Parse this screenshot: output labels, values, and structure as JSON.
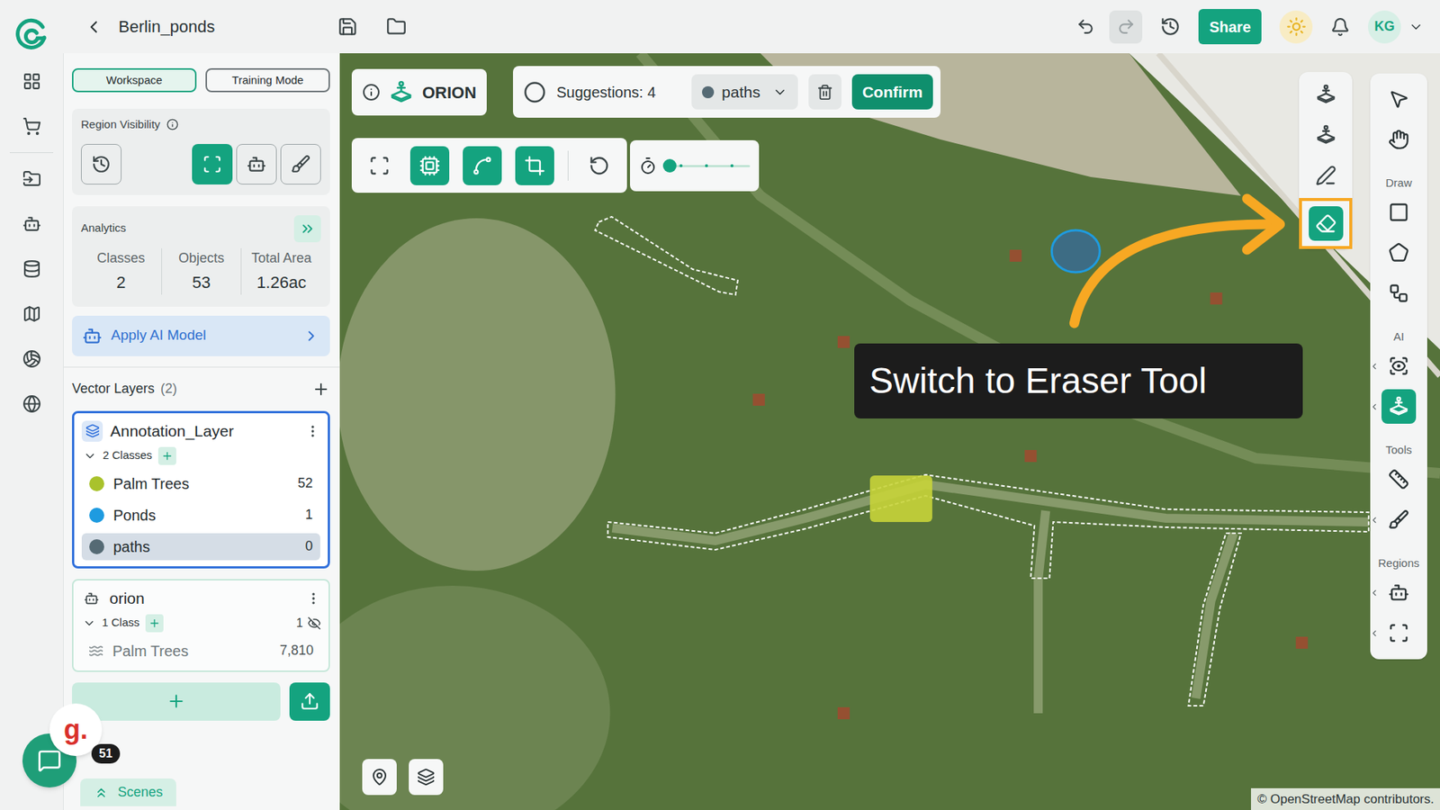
{
  "header": {
    "title": "Berlin_ponds",
    "undo_disabled": false,
    "redo_disabled": true,
    "share": "Share",
    "user_initials": "KG"
  },
  "mode_tabs": [
    {
      "label": "Workspace",
      "selected": true
    },
    {
      "label": "Training Mode",
      "selected": false
    }
  ],
  "region_visibility": {
    "label": "Region Visibility",
    "buttons": [
      {
        "kind": "history",
        "selected": false
      },
      {
        "kind": "full",
        "selected": true
      },
      {
        "kind": "robot",
        "selected": false
      },
      {
        "kind": "brush",
        "selected": false
      }
    ]
  },
  "analytics": {
    "title": "Analytics",
    "stats": [
      {
        "label": "Classes",
        "value": "2"
      },
      {
        "label": "Objects",
        "value": "53"
      },
      {
        "label": "Total Area",
        "value": "1.26ac"
      }
    ]
  },
  "apply_ai": {
    "label": "Apply AI Model"
  },
  "vector_layers": {
    "title": "Vector Layers",
    "count": "(2)",
    "layers": [
      {
        "name": "Annotation_Layer",
        "kind": "annotation",
        "classes_label": "2 Classes",
        "selected": true,
        "hidden_count": "",
        "classes": [
          {
            "name": "Palm Trees",
            "count": "52",
            "color": "#a9c22c",
            "selected": false,
            "hidden": false
          },
          {
            "name": "Ponds",
            "count": "1",
            "color": "#1e9be0",
            "selected": false,
            "hidden": false
          },
          {
            "name": "paths",
            "count": "0",
            "color": "#556a74",
            "selected": true,
            "hidden": false
          }
        ]
      },
      {
        "name": "orion",
        "kind": "model",
        "classes_label": "1 Class",
        "selected": false,
        "hidden_count": "1",
        "classes": [
          {
            "name": "Palm Trees",
            "count": "7,810",
            "color": "#8a9396",
            "selected": false,
            "hidden": true
          }
        ]
      }
    ]
  },
  "scenes": {
    "label": "Scenes"
  },
  "chat": {
    "avatar": "g.",
    "badge": "51"
  },
  "map": {
    "orion": {
      "label": "ORION"
    },
    "suggestions": {
      "label": "Suggestions: 4",
      "class": "paths",
      "class_color": "#556a74",
      "confirm": "Confirm"
    },
    "tools": [
      {
        "kind": "scan",
        "selected": false
      },
      {
        "kind": "chip",
        "selected": true
      },
      {
        "kind": "curve",
        "selected": true
      },
      {
        "kind": "crop",
        "selected": true
      },
      {
        "kind": "reset",
        "selected": false
      }
    ],
    "slider": {
      "level": 0
    },
    "quick_tools": [
      {
        "kind": "orion-outline",
        "selected": false,
        "highlighted": false
      },
      {
        "kind": "orion",
        "selected": false,
        "highlighted": false
      },
      {
        "kind": "pen",
        "selected": false,
        "highlighted": false
      },
      {
        "kind": "eraser",
        "selected": true,
        "highlighted": true
      }
    ],
    "toolbar": [
      {
        "label": "",
        "items": [
          {
            "kind": "select",
            "selected": false,
            "has_menu": false
          },
          {
            "kind": "pan",
            "selected": false,
            "has_menu": false
          }
        ]
      },
      {
        "label": "Draw",
        "items": [
          {
            "kind": "rect",
            "selected": false,
            "has_menu": false
          },
          {
            "kind": "polygon",
            "selected": false,
            "has_menu": false
          },
          {
            "kind": "nodes",
            "selected": false,
            "has_menu": false
          }
        ]
      },
      {
        "label": "AI",
        "items": [
          {
            "kind": "ai-detect",
            "selected": false,
            "has_menu": true
          },
          {
            "kind": "orion",
            "selected": true,
            "has_menu": true
          }
        ]
      },
      {
        "label": "Tools",
        "items": [
          {
            "kind": "ruler",
            "selected": false,
            "has_menu": false
          },
          {
            "kind": "brush",
            "selected": false,
            "has_menu": true
          }
        ]
      },
      {
        "label": "Regions",
        "items": [
          {
            "kind": "robot",
            "selected": false,
            "has_menu": true
          },
          {
            "kind": "fullscreen",
            "selected": false,
            "has_menu": true
          }
        ]
      }
    ],
    "tooltip": "Switch to Eraser Tool",
    "attribution": "© OpenStreetMap contributors."
  }
}
